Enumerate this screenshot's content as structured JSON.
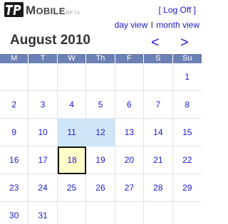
{
  "logo": {
    "mark": "TP",
    "m": "M",
    "rest": "OBILE",
    "beta": "BETA"
  },
  "header": {
    "logoff": "[ Log Off ]"
  },
  "views": {
    "day": "day view",
    "separator": "I",
    "month": "month view"
  },
  "calendar": {
    "month_title": "August 2010",
    "prev": "<",
    "next": ">",
    "weekdays": [
      "M",
      "T",
      "W",
      "Th",
      "F",
      "S",
      "Su"
    ],
    "weeks": [
      [
        "",
        "",
        "",
        "",
        "",
        "",
        "1"
      ],
      [
        "2",
        "3",
        "4",
        "5",
        "6",
        "7",
        "8"
      ],
      [
        "9",
        "10",
        "11",
        "12",
        "13",
        "14",
        "15"
      ],
      [
        "16",
        "17",
        "18",
        "19",
        "20",
        "21",
        "22"
      ],
      [
        "23",
        "24",
        "25",
        "26",
        "27",
        "28",
        "29"
      ],
      [
        "30",
        "31",
        "",
        "",
        "",
        "",
        ""
      ]
    ],
    "highlighted_days": [
      "11",
      "12"
    ],
    "today": "18"
  },
  "colors": {
    "link": "#1a1acc",
    "weekday_bar": "#6b80b4",
    "highlight": "#cfe6f9",
    "today_fill": "#fefdc8"
  },
  "icons": {
    "logo": "tp-logo-icon"
  }
}
